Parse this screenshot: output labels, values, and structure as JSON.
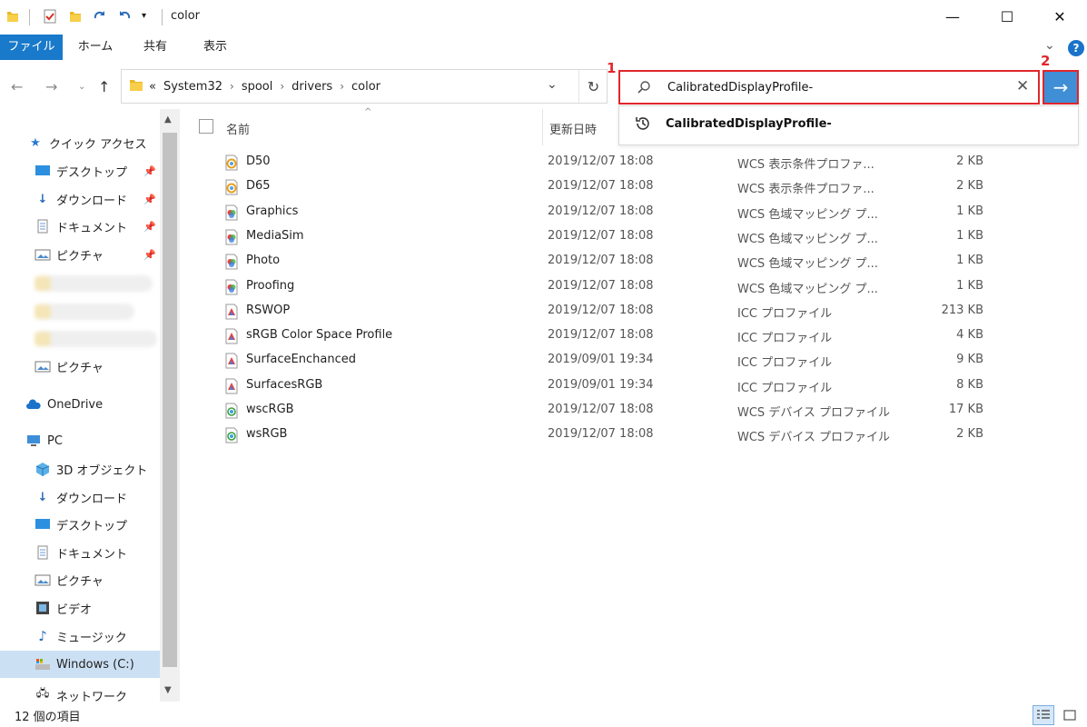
{
  "window": {
    "title": "color",
    "controls": {
      "minimize": "—",
      "maximize": "☐",
      "close": "✕"
    }
  },
  "ribbon": {
    "tabs": [
      "ファイル",
      "ホーム",
      "共有",
      "表示"
    ],
    "help": "?"
  },
  "address": {
    "crumbs": [
      "«",
      "System32",
      "spool",
      "drivers",
      "color"
    ]
  },
  "search": {
    "value": "CalibratedDisplayProfile-",
    "go_label": "→",
    "suggestion": "CalibratedDisplayProfile-"
  },
  "markers": {
    "one": "1",
    "two": "2"
  },
  "sidebar": {
    "quick_access": "クイック アクセス",
    "pinned": [
      {
        "label": "デスクトップ",
        "icon": "desktop-icon"
      },
      {
        "label": "ダウンロード",
        "icon": "download-icon"
      },
      {
        "label": "ドキュメント",
        "icon": "document-icon"
      },
      {
        "label": "ピクチャ",
        "icon": "pictures-icon"
      }
    ],
    "pictures2": "ピクチャ",
    "onedrive": "OneDrive",
    "pc": "PC",
    "pc_items": [
      {
        "label": "3D オブジェクト",
        "icon": "3d-objects-icon"
      },
      {
        "label": "ダウンロード",
        "icon": "download-icon"
      },
      {
        "label": "デスクトップ",
        "icon": "desktop-icon"
      },
      {
        "label": "ドキュメント",
        "icon": "document-icon"
      },
      {
        "label": "ピクチャ",
        "icon": "pictures-icon"
      },
      {
        "label": "ビデオ",
        "icon": "video-icon"
      },
      {
        "label": "ミュージック",
        "icon": "music-icon"
      },
      {
        "label": "Windows (C:)",
        "icon": "drive-icon"
      }
    ],
    "network_partial": "ネットワーク"
  },
  "list": {
    "headers": {
      "name": "名前",
      "date": "更新日時"
    },
    "files": [
      {
        "name": "D50",
        "date": "2019/12/07 18:08",
        "type": "WCS 表示条件プロファ...",
        "size": "2 KB",
        "kind": "wcs"
      },
      {
        "name": "D65",
        "date": "2019/12/07 18:08",
        "type": "WCS 表示条件プロファ...",
        "size": "2 KB",
        "kind": "wcs"
      },
      {
        "name": "Graphics",
        "date": "2019/12/07 18:08",
        "type": "WCS 色域マッピング プ...",
        "size": "1 KB",
        "kind": "gamut"
      },
      {
        "name": "MediaSim",
        "date": "2019/12/07 18:08",
        "type": "WCS 色域マッピング プ...",
        "size": "1 KB",
        "kind": "gamut"
      },
      {
        "name": "Photo",
        "date": "2019/12/07 18:08",
        "type": "WCS 色域マッピング プ...",
        "size": "1 KB",
        "kind": "gamut"
      },
      {
        "name": "Proofing",
        "date": "2019/12/07 18:08",
        "type": "WCS 色域マッピング プ...",
        "size": "1 KB",
        "kind": "gamut"
      },
      {
        "name": "RSWOP",
        "date": "2019/12/07 18:08",
        "type": "ICC プロファイル",
        "size": "213 KB",
        "kind": "icc"
      },
      {
        "name": "sRGB Color Space Profile",
        "date": "2019/12/07 18:08",
        "type": "ICC プロファイル",
        "size": "4 KB",
        "kind": "icc"
      },
      {
        "name": "SurfaceEnchanced",
        "date": "2019/09/01 19:34",
        "type": "ICC プロファイル",
        "size": "9 KB",
        "kind": "icc"
      },
      {
        "name": "SurfacesRGB",
        "date": "2019/09/01 19:34",
        "type": "ICC プロファイル",
        "size": "8 KB",
        "kind": "icc"
      },
      {
        "name": "wscRGB",
        "date": "2019/12/07 18:08",
        "type": "WCS デバイス プロファイル",
        "size": "17 KB",
        "kind": "device"
      },
      {
        "name": "wsRGB",
        "date": "2019/12/07 18:08",
        "type": "WCS デバイス プロファイル",
        "size": "2 KB",
        "kind": "device"
      }
    ]
  },
  "status": {
    "count": "12 個の項目"
  },
  "colors": {
    "accent": "#1979ca",
    "highlight_red": "#e0262b",
    "go_button": "#3f8ed6",
    "selected": "#cce0f4"
  }
}
